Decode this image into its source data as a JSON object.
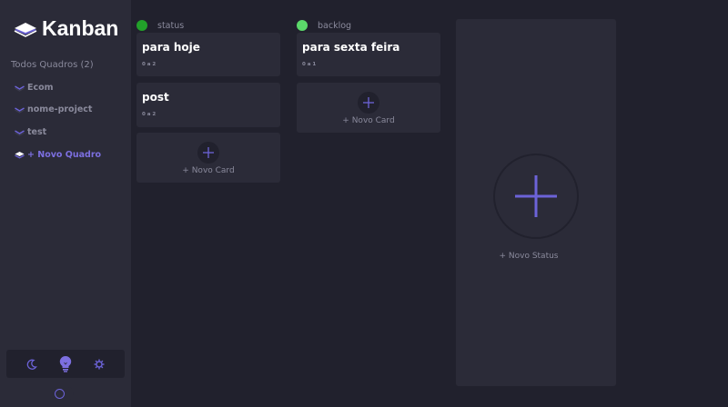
{
  "app": {
    "name": "Kanban"
  },
  "colors": {
    "accent": "#6c63d8",
    "sidebar": "#2b2b38",
    "background": "#21212d",
    "muted": "#8a8a9c"
  },
  "sidebar": {
    "boards_heading": "Todos Quadros (2)",
    "boards": [
      {
        "label": "Ecom"
      },
      {
        "label": "nome-project"
      },
      {
        "label": "test"
      }
    ],
    "new_board_label": "+ Novo Quadro",
    "theme_icons": [
      "moon-icon",
      "lightbulb-icon",
      "gear-icon"
    ]
  },
  "columns": [
    {
      "name": "status",
      "dot_color": "#22a02a",
      "cards": [
        {
          "title": "para hoje",
          "subtasks": "0 a 2"
        },
        {
          "title": "post",
          "subtasks": "0 a 2"
        }
      ],
      "new_card_label": "+ Novo Card"
    },
    {
      "name": "backlog",
      "dot_color": "#5bd86a",
      "cards": [
        {
          "title": "para sexta feira",
          "subtasks": "0 a 1"
        }
      ],
      "new_card_label": "+ Novo Card"
    }
  ],
  "new_status_label": "+ Novo Status"
}
